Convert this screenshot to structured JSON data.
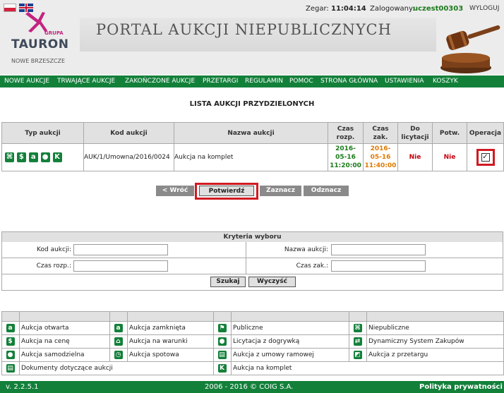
{
  "header": {
    "clock_label": "Zegar:",
    "clock_value": "11:04:14",
    "logged_label": "Zalogowany:",
    "logged_user": "uczest00303",
    "logout": "WYLOGUJ",
    "logo_grupa": "GRUPA",
    "logo_name": "TAURON",
    "logo_city": "NOWE BRZESZCZE",
    "portal_title": "PORTAL AUKCJI NIEPUBLICZNYCH",
    "flags": [
      "pl-flag-icon",
      "uk-flag-icon"
    ]
  },
  "menu": [
    "NOWE AUKCJE",
    "TRWAJĄCE AUKCJE",
    "ZAKOŃCZONE AUKCJE",
    "PRZETARGI",
    "REGULAMIN",
    "POMOC",
    "STRONA GŁÓWNA",
    "USTAWIENIA",
    "KOSZYK"
  ],
  "list": {
    "title": "LISTA AUKCJI PRZYDZIELONYCH",
    "headers": {
      "type": "Typ aukcji",
      "code": "Kod aukcji",
      "name": "Nazwa aukcji",
      "start_1": "Czas",
      "start_2": "rozp.",
      "end_1": "Czas",
      "end_2": "zak.",
      "bid_1": "Do",
      "bid_2": "licytacji",
      "confirm": "Potw.",
      "operation": "Operacja"
    },
    "rows": [
      {
        "icons": [
          "closed-type-icon",
          "price-icon",
          "lock-icon",
          "eye-icon",
          "package-icon"
        ],
        "icon_glyphs": [
          "⌘",
          "$",
          "a",
          "●",
          "K"
        ],
        "code": "AUK/1/Umowna/2016/0024",
        "name": "Aukcja na komplet",
        "start_date_1": "2016-",
        "start_date_2": "05-16",
        "start_time": "11:20:00",
        "end_date_1": "2016-",
        "end_date_2": "05-16",
        "end_time": "11:40:00",
        "bid": "Nie",
        "confirmed": "Nie",
        "checked": true
      }
    ]
  },
  "buttons": {
    "back": "< Wróć",
    "confirm": "Potwierdź",
    "select": "Zaznacz",
    "deselect": "Odznacz"
  },
  "criteria": {
    "title": "Kryteria wyboru",
    "code_label": "Kod aukcji:",
    "name_label": "Nazwa aukcji:",
    "start_label": "Czas rozp.:",
    "end_label": "Czas zak.:",
    "search": "Szukaj",
    "clear": "Wyczyść"
  },
  "legend": [
    {
      "icon": "lock-icon",
      "glyph": "a",
      "text": "Aukcja otwarta"
    },
    {
      "icon": "closed-lock-icon",
      "glyph": "a",
      "text": "Aukcja zamknięta"
    },
    {
      "icon": "flag-icon",
      "glyph": "⚑",
      "text": "Publiczne"
    },
    {
      "icon": "nonpublic-icon",
      "glyph": "⌘",
      "text": "Niepubliczne"
    },
    {
      "icon": "dollar-icon",
      "glyph": "$",
      "text": "Aukcja na cenę"
    },
    {
      "icon": "cart-icon",
      "glyph": "⌂",
      "text": "Aukcja na warunki"
    },
    {
      "icon": "stopwatch-icon",
      "glyph": "●",
      "text": "Licytacja z dogrywką"
    },
    {
      "icon": "dps-icon",
      "glyph": "⇄",
      "text": "Dynamiczny System Zakupów"
    },
    {
      "icon": "person-icon",
      "glyph": "●",
      "text": "Aukcja samodzielna"
    },
    {
      "icon": "clock-icon",
      "glyph": "◷",
      "text": "Aukcja spotowa"
    },
    {
      "icon": "document-icon",
      "glyph": "▤",
      "text": "Aukcja z umowy ramowej"
    },
    {
      "icon": "tender-icon",
      "glyph": "◩",
      "text": "Aukcja z przetargu"
    },
    {
      "icon": "docs-icon",
      "glyph": "▤",
      "text": "Dokumenty dotyczące aukcji"
    },
    {
      "icon": "package-icon",
      "glyph": "K",
      "text": "Aukcja na komplet"
    }
  ],
  "footer": {
    "version": "v. 2.2.5.1",
    "copyright": "2006 - 2016 © COIG S.A.",
    "privacy": "Polityka prywatności"
  }
}
